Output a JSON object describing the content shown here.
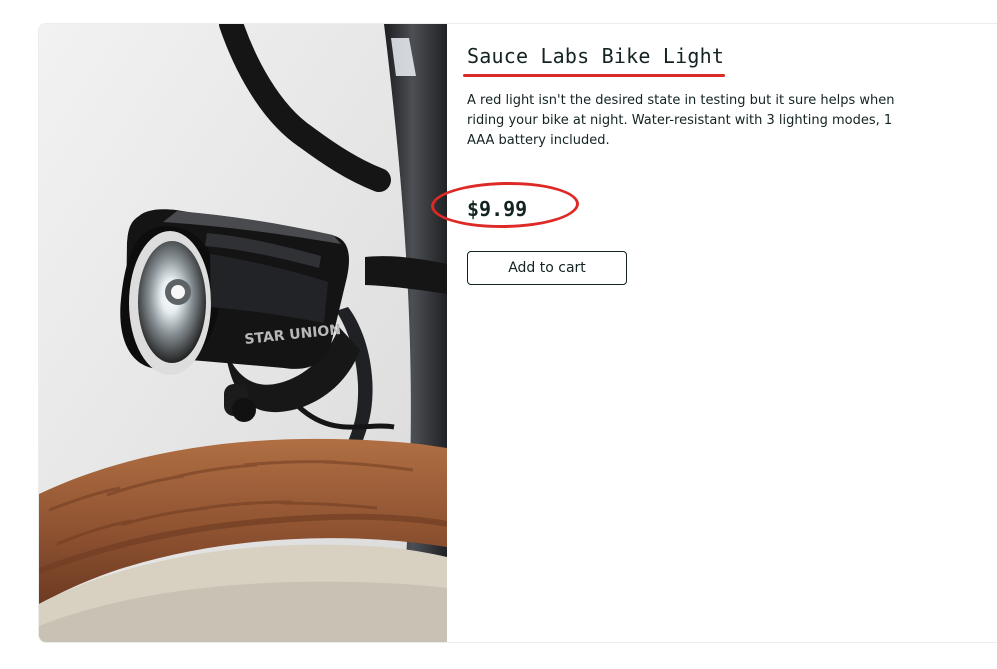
{
  "product": {
    "title": "Sauce Labs Bike Light",
    "description": "A red light isn't the desired state in testing but it sure helps when riding your bike at night. Water-resistant with 3 lighting modes, 1 AAA battery included.",
    "price": "$9.99",
    "add_to_cart_label": "Add to cart",
    "image_alt": "Sauce Labs Bike Light",
    "image_brand_text": "STAR UNION"
  },
  "annotations": {
    "title_underline_color": "#d72c27",
    "price_circle_color": "#dd2a26"
  }
}
